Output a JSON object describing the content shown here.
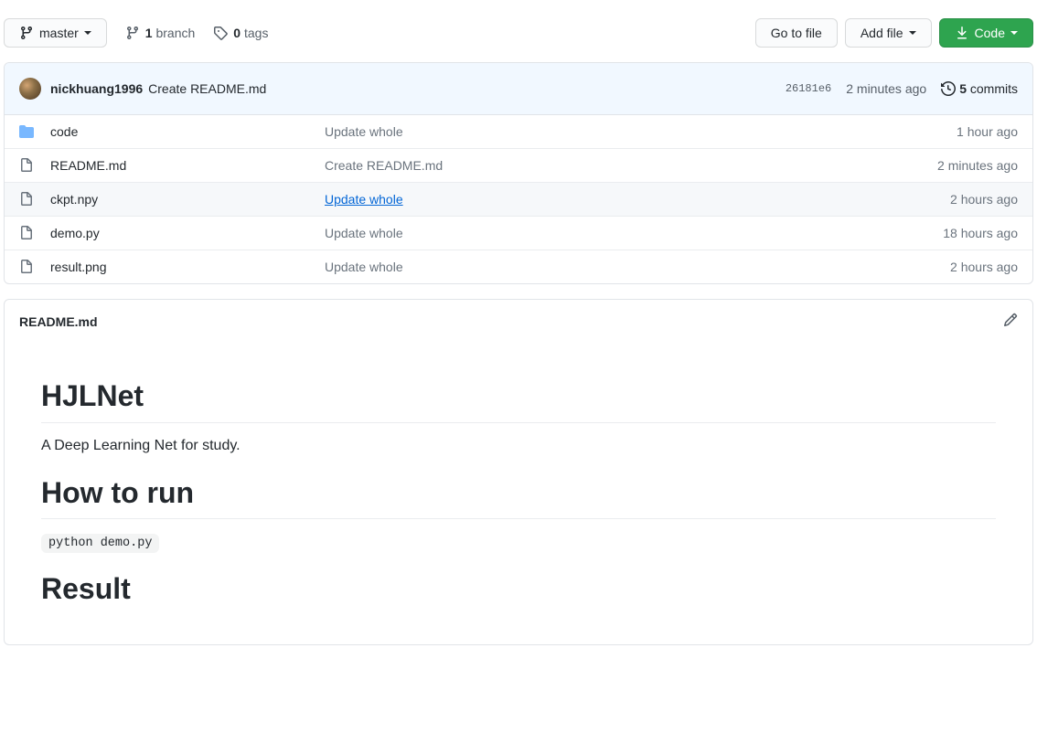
{
  "toolbar": {
    "branch_label": "master",
    "branch_count": "1",
    "branch_word": "branch",
    "tag_count": "0",
    "tag_word": "tags",
    "goto_file": "Go to file",
    "add_file": "Add file",
    "code": "Code"
  },
  "commit": {
    "author": "nickhuang1996",
    "message": "Create README.md",
    "sha": "26181e6",
    "time": "2 minutes ago",
    "commits_count": "5",
    "commits_word": "commits"
  },
  "files": [
    {
      "type": "dir",
      "name": "code",
      "msg": "Update whole",
      "time": "1 hour ago"
    },
    {
      "type": "file",
      "name": "README.md",
      "msg": "Create README.md",
      "time": "2 minutes ago"
    },
    {
      "type": "file",
      "name": "ckpt.npy",
      "msg": "Update whole",
      "time": "2 hours ago",
      "hovered": true
    },
    {
      "type": "file",
      "name": "demo.py",
      "msg": "Update whole",
      "time": "18 hours ago"
    },
    {
      "type": "file",
      "name": "result.png",
      "msg": "Update whole",
      "time": "2 hours ago"
    }
  ],
  "readme": {
    "filename": "README.md",
    "h1": "HJLNet",
    "desc": "A Deep Learning Net for study.",
    "h2a": "How to run",
    "code": "python demo.py",
    "h2b": "Result"
  }
}
